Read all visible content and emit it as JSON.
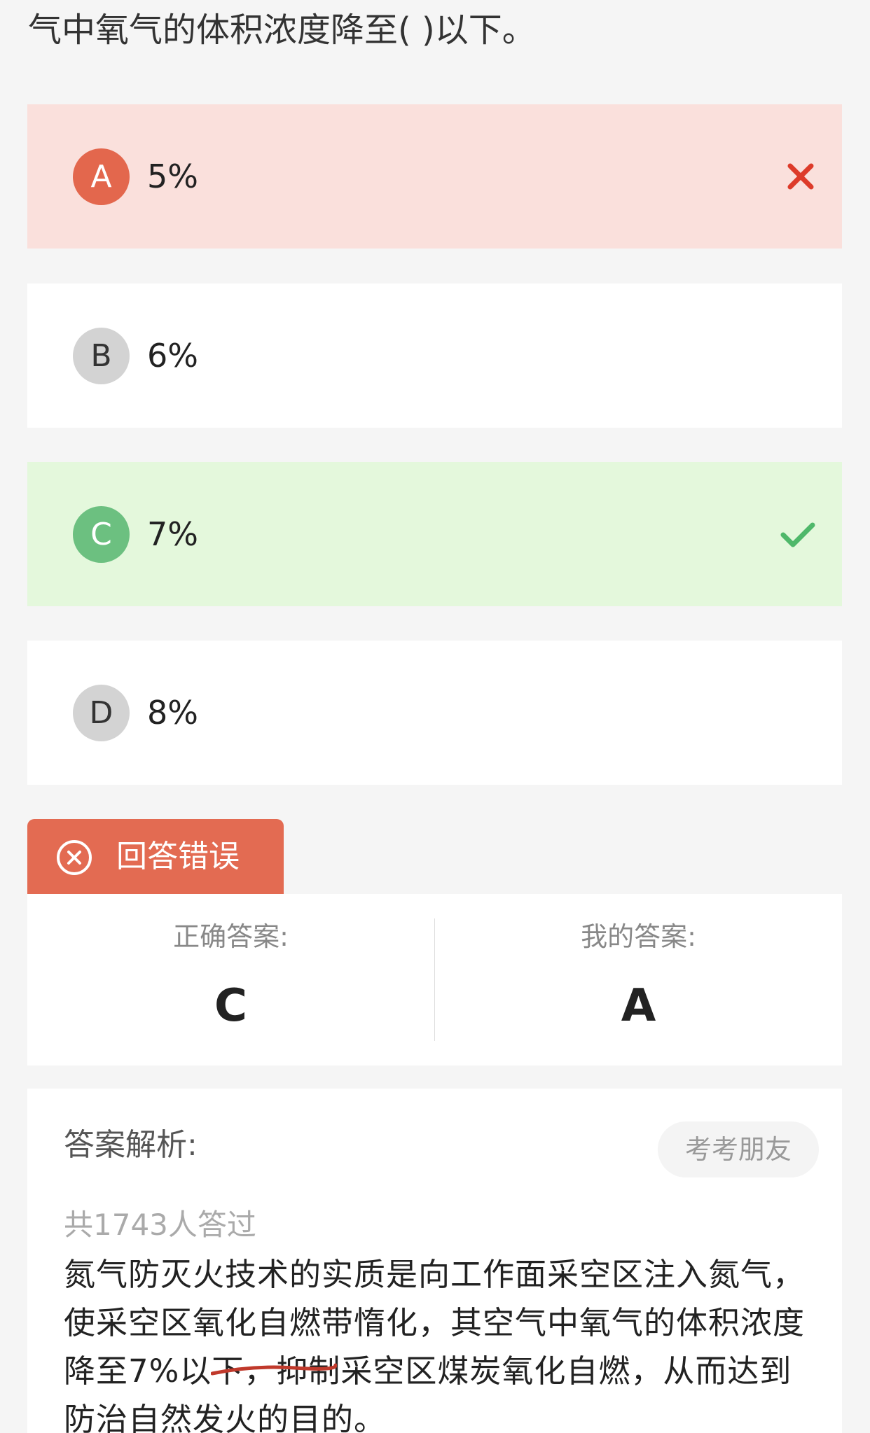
{
  "question": {
    "tail_text": "气中氧气的体积浓度降至( )以下。"
  },
  "options": [
    {
      "letter": "A",
      "text": "5%",
      "state": "wrong",
      "mark_icon": "cross-icon"
    },
    {
      "letter": "B",
      "text": "6%",
      "state": "normal"
    },
    {
      "letter": "C",
      "text": "7%",
      "state": "correct",
      "mark_icon": "check-icon"
    },
    {
      "letter": "D",
      "text": "8%",
      "state": "normal"
    }
  ],
  "result": {
    "status_label": "回答错误",
    "icon": "circle-x-icon",
    "correct_answer_label": "正确答案:",
    "correct_answer_value": "C",
    "my_answer_label": "我的答案:",
    "my_answer_value": "A"
  },
  "analysis": {
    "title": "答案解析:",
    "friend_button_label": "考考朋友",
    "answered_count_text": "共1743人答过",
    "body_text": "氮气防灭火技术的实质是向工作面采空区注入氮气，使采空区氧化自燃带惰化，其空气中氧气的体积浓度降至7%以下，抑制采空区煤炭氧化自燃，从而达到防治自然发火的目的。"
  },
  "colors": {
    "background": "#f5f5f5",
    "wrong_bg": "#fae0dc",
    "wrong_accent": "#e3674d",
    "correct_bg": "#e4f8dc",
    "correct_accent": "#6cc080",
    "tab_bg": "#e36b52",
    "strike_mark": "#c0392b"
  }
}
